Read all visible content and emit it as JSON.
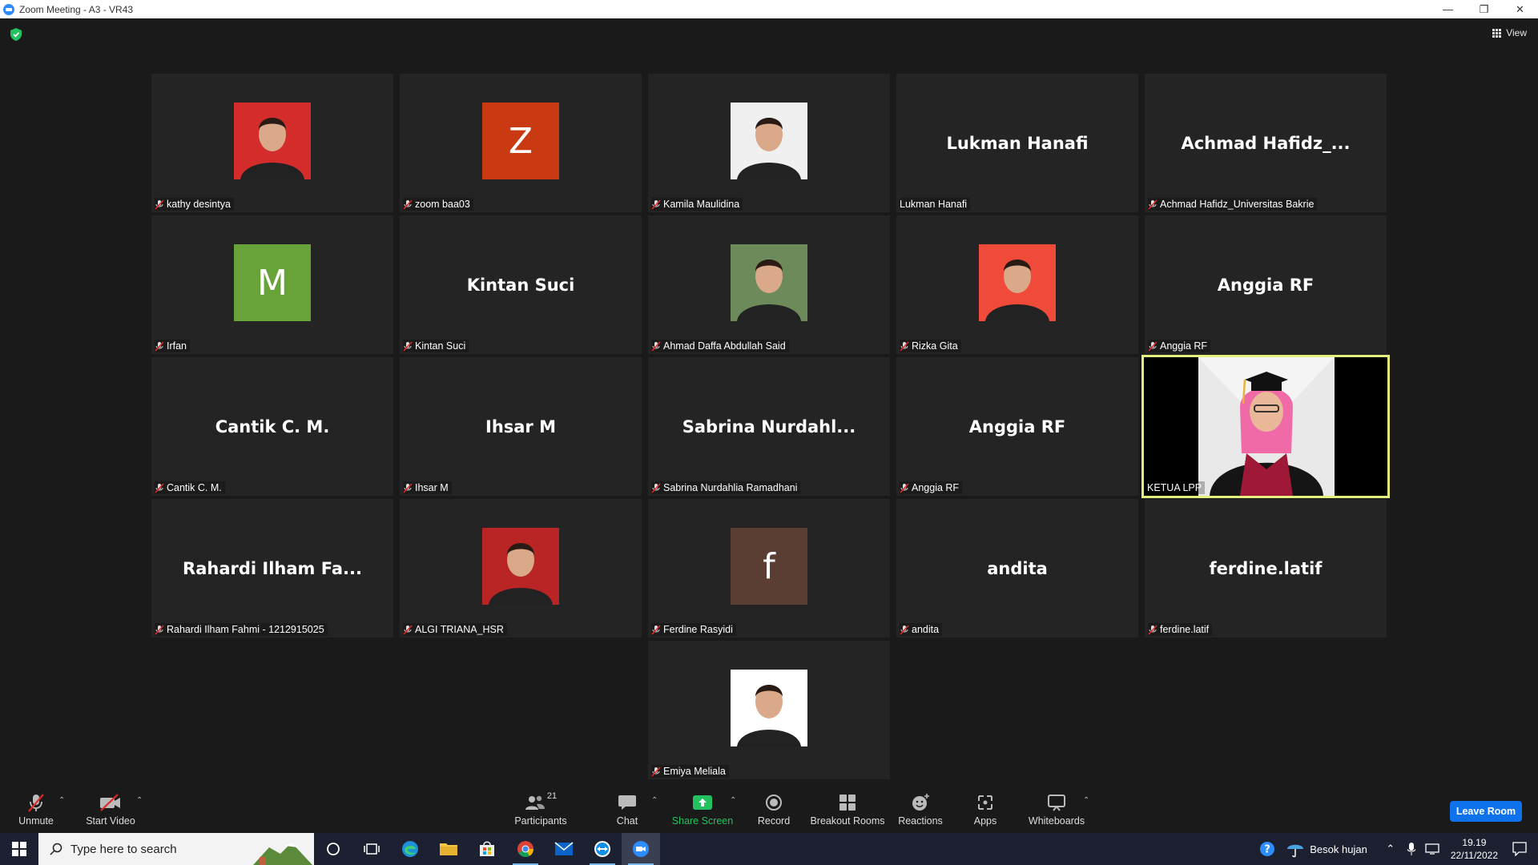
{
  "window": {
    "title": "Zoom Meeting - A3 - VR43",
    "controls": [
      "—",
      "❐",
      "✕"
    ]
  },
  "meeting": {
    "view_label": "View"
  },
  "participants_grid": [
    {
      "tile_name": "kathy desintya",
      "muted": true,
      "avatar": "photo",
      "color": "#d42b2b"
    },
    {
      "tile_name": "zoom baa03",
      "muted": true,
      "avatar": "letter",
      "letter": "Z",
      "color": "#c93a12"
    },
    {
      "tile_name": "Kamila Maulidina",
      "muted": true,
      "avatar": "photo",
      "color": "#f0f0f0"
    },
    {
      "tile_name": "Lukman Hanafi",
      "muted": false,
      "avatar": "name",
      "display": "Lukman Hanafi"
    },
    {
      "tile_name": "Achmad Hafidz_Universitas Bakrie",
      "muted": true,
      "avatar": "name",
      "display": "Achmad  Hafidz_..."
    },
    {
      "tile_name": "Irfan",
      "muted": true,
      "avatar": "letter",
      "letter": "M",
      "color": "#67a338"
    },
    {
      "tile_name": "Kintan Suci",
      "muted": true,
      "avatar": "name",
      "display": "Kintan Suci"
    },
    {
      "tile_name": "Ahmad Daffa Abdullah Said",
      "muted": true,
      "avatar": "photo",
      "color": "#6c8a5a"
    },
    {
      "tile_name": "Rizka Gita",
      "muted": true,
      "avatar": "photo",
      "color": "#f04a3a"
    },
    {
      "tile_name": "Anggia RF",
      "muted": true,
      "avatar": "name",
      "display": "Anggia RF"
    },
    {
      "tile_name": "Cantik C. M.",
      "muted": true,
      "avatar": "name",
      "display": "Cantik C. M."
    },
    {
      "tile_name": "Ihsar M",
      "muted": true,
      "avatar": "name",
      "display": "Ihsar M"
    },
    {
      "tile_name": "Sabrina Nurdahlia Ramadhani",
      "muted": true,
      "avatar": "name",
      "display": "Sabrina  Nurdahl..."
    },
    {
      "tile_name": "Anggia RF",
      "muted": true,
      "avatar": "name",
      "display": "Anggia RF"
    },
    {
      "tile_name": "KETUA LPP",
      "muted": false,
      "avatar": "video",
      "active_speaker": true
    },
    {
      "tile_name": "Rahardi Ilham Fahmi - 1212915025",
      "muted": true,
      "avatar": "name",
      "display": "Rahardi  Ilham  Fa..."
    },
    {
      "tile_name": "ALGI TRIANA_HSR",
      "muted": true,
      "avatar": "photo",
      "color": "#b92424"
    },
    {
      "tile_name": "Ferdine Rasyidi",
      "muted": true,
      "avatar": "letter",
      "letter": "f",
      "color": "#5a3d33"
    },
    {
      "tile_name": "andita",
      "muted": true,
      "avatar": "name",
      "display": "andita"
    },
    {
      "tile_name": "ferdine.latif",
      "muted": true,
      "avatar": "name",
      "display": "ferdine.latif"
    },
    {
      "tile_name": "Emiya Meliala",
      "muted": true,
      "avatar": "photo",
      "color": "#ffffff"
    }
  ],
  "toolbar": {
    "unmute": "Unmute",
    "start_video": "Start Video",
    "participants": "Participants",
    "participants_count": "21",
    "chat": "Chat",
    "share_screen": "Share Screen",
    "record": "Record",
    "breakout_rooms": "Breakout Rooms",
    "reactions": "Reactions",
    "apps": "Apps",
    "whiteboards": "Whiteboards",
    "leave": "Leave Room"
  },
  "taskbar": {
    "search_placeholder": "Type here to search",
    "weather": "Besok hujan",
    "time": "19.19",
    "date": "22/11/2022",
    "apps": [
      "cortana-icon",
      "task-view-icon",
      "edge-icon",
      "file-explorer-icon",
      "store-icon",
      "chrome-icon",
      "mail-icon",
      "teamviewer-icon",
      "zoom-icon"
    ]
  },
  "colors": {
    "accent": "#0e72ed",
    "active_speaker_border": "#e6ef7e",
    "share_green": "#23c160",
    "mute_red": "#e02828"
  }
}
